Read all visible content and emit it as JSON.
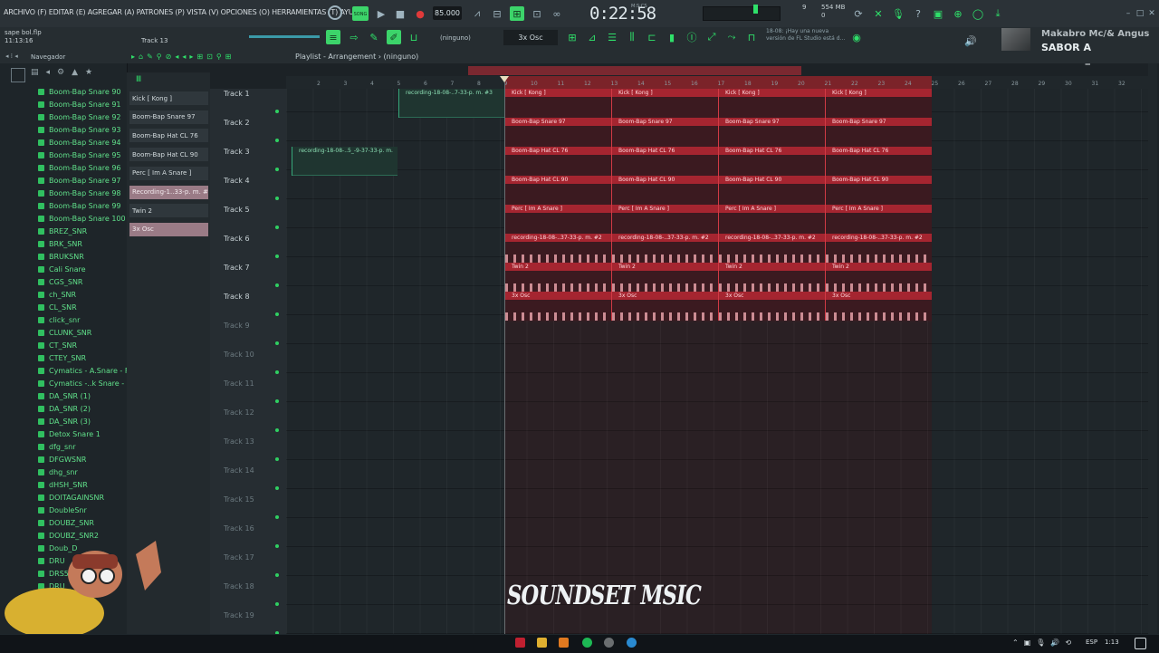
{
  "menu": {
    "text": "ARCHIVO (F) EDITAR (E) AGREGAR (A) PATRONES (P) VISTA (V) OPCIONES (O) HERRAMIENTAS (T) AYUDA"
  },
  "transport": {
    "song_label": "SONG",
    "tempo": "85.000",
    "time": "0:22:58",
    "time_sub": "M:S:CS",
    "cpu": "9",
    "memory": "554 MB",
    "memory_sub": "0"
  },
  "project": {
    "filename": "sape bol.flp",
    "position": "11:13:16",
    "pattern": "Track 13"
  },
  "toolbar2": {
    "snap": "(ninguno)",
    "channel": "3x Osc",
    "hint_title": "18-08: ¡Hay una nueva",
    "hint_sub": "versión de FL Studio está d..."
  },
  "now_playing": {
    "artist": "Makabro Mc/& Angus",
    "song": "SABOR A MUSICA_M..."
  },
  "browser": {
    "title": "Navegador",
    "items": [
      "Boom-Bap Snare 90",
      "Boom-Bap Snare 91",
      "Boom-Bap Snare 92",
      "Boom-Bap Snare 93",
      "Boom-Bap Snare 94",
      "Boom-Bap Snare 95",
      "Boom-Bap Snare 96",
      "Boom-Bap Snare 97",
      "Boom-Bap Snare 98",
      "Boom-Bap Snare 99",
      "Boom-Bap Snare 100",
      "BREZ_SNR",
      "BRK_SNR",
      "BRUKSNR",
      "Cali Snare",
      "CGS_SNR",
      "ch_SNR",
      "CL_SNR",
      "click_snr",
      "CLUNK_SNR",
      "CT_SNR",
      "CTEY_SNR",
      "Cymatics - A.Snare - F#",
      "Cymatics -..k Snare - B",
      "DA_SNR (1)",
      "DA_SNR (2)",
      "DA_SNR (3)",
      "Detox Snare 1",
      "dfg_snr",
      "DFGWSNR",
      "dhg_snr",
      "dHSH_SNR",
      "DOITAGAINSNR",
      "DoubleSnr",
      "DOUBZ_SNR",
      "DOUBZ_SNR2",
      "Doub_D",
      "DRU",
      "DRS5",
      "DRU"
    ]
  },
  "picker": {
    "items": [
      "Kick [ Kong ]",
      "Boom-Bap Snare 97",
      "Boom-Bap Hat CL 76",
      "Boom-Bap Hat CL 90",
      "Perc [ Im A Snare ]",
      "Recording-1..33-p. m. #2",
      "Twin 2",
      "3x Osc"
    ],
    "selected": [
      5,
      7
    ]
  },
  "playlist": {
    "title": "Playlist - Arrangement",
    "arrangement": "(ninguno)",
    "ruler": [
      "2",
      "3",
      "4",
      "5",
      "6",
      "7",
      "8",
      "9",
      "10",
      "11",
      "12",
      "13",
      "14",
      "15",
      "16",
      "17",
      "18",
      "19",
      "20",
      "21",
      "22",
      "23",
      "24",
      "25",
      "26",
      "27",
      "28",
      "29",
      "30",
      "31",
      "32"
    ],
    "tracks": [
      "Track 1",
      "Track 2",
      "Track 3",
      "Track 4",
      "Track 5",
      "Track 6",
      "Track 7",
      "Track 8",
      "Track 9",
      "Track 10",
      "Track 11",
      "Track 12",
      "Track 13",
      "Track 14",
      "Track 15",
      "Track 16",
      "Track 17",
      "Track 18",
      "Track 19"
    ],
    "clips": [
      {
        "track": 0,
        "label": "Kick [ Kong ]"
      },
      {
        "track": 1,
        "label": "Boom-Bap Snare 97"
      },
      {
        "track": 2,
        "label": "Boom-Bap Hat CL 76"
      },
      {
        "track": 3,
        "label": "Boom-Bap Hat CL 90"
      },
      {
        "track": 4,
        "label": "Perc [ Im A Snare ]"
      },
      {
        "track": 5,
        "label": "recording-18-08-..37-33-p. m. #2"
      },
      {
        "track": 6,
        "label": "Twin 2"
      },
      {
        "track": 7,
        "label": "3x Osc"
      }
    ],
    "audio_clips": [
      {
        "track": 0,
        "label": "recording-18-08-..7-33-p. m. #3"
      },
      {
        "track": 2,
        "label": "recording-18-08-..5_-9-37-33-p. m."
      }
    ]
  },
  "watermark": "SOUNDSET MSIC",
  "taskbar": {
    "lang": "ESP",
    "time": "1:13"
  }
}
